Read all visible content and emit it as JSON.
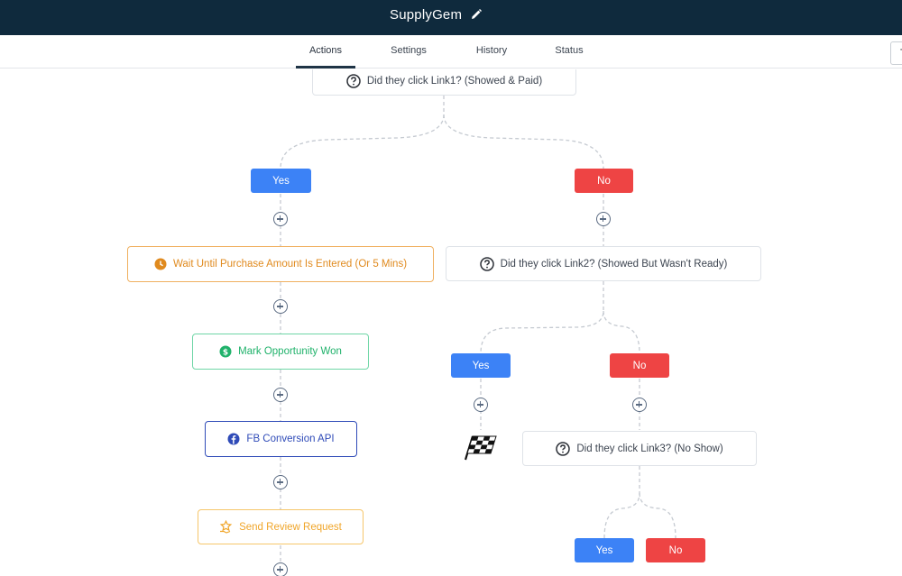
{
  "app": {
    "title": "SupplyGem"
  },
  "tabs": [
    {
      "label": "Actions",
      "active": true
    },
    {
      "label": "Settings"
    },
    {
      "label": "History"
    },
    {
      "label": "Status"
    }
  ],
  "corner_box": {
    "label": "T"
  },
  "workflow": {
    "condition1": "Did they click Link1? (Showed & Paid)",
    "condition2": "Did they click Link2? (Showed But Wasn't Ready)",
    "condition3": "Did they click Link3? (No Show)",
    "branch_yes": "Yes",
    "branch_no": "No",
    "wait": "Wait Until Purchase Amount Is Entered (Or 5 Mins)",
    "won": "Mark Opportunity Won",
    "fb": "FB Conversion API",
    "review": "Send Review Request"
  },
  "colors": {
    "header_bg": "#0f2a3d",
    "yes": "#3c82f6",
    "no": "#ee4444",
    "wait": "#e08a1e",
    "won": "#20b26b",
    "fb": "#2f4bb8",
    "review": "#f0a528"
  },
  "icons": {
    "edit": "pencil-icon",
    "condition": "question-circle-icon",
    "wait": "clock-icon",
    "won": "dollar-circle-icon",
    "fb": "facebook-icon",
    "review": "star-hand-icon",
    "add": "plus-circle-icon",
    "finish": "checkered-flag-icon"
  }
}
